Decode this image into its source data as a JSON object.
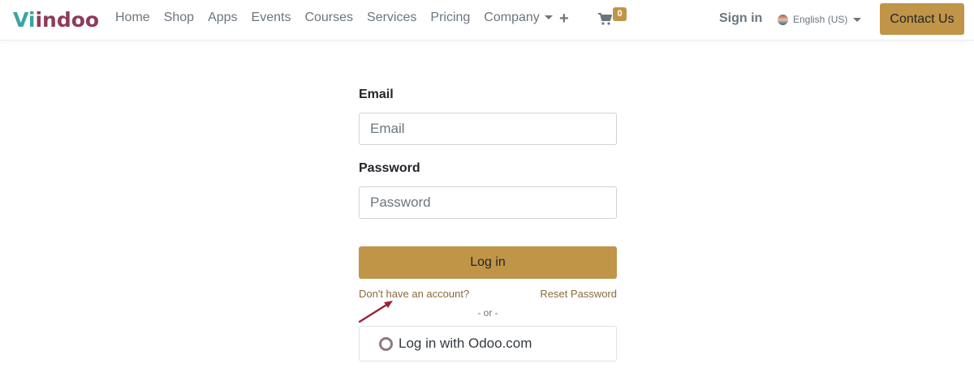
{
  "brand": {
    "logo_first": "Vi",
    "logo_rest": "indoo"
  },
  "nav": {
    "items": [
      {
        "label": "Home"
      },
      {
        "label": "Shop"
      },
      {
        "label": "Apps"
      },
      {
        "label": "Events"
      },
      {
        "label": "Courses"
      },
      {
        "label": "Services"
      },
      {
        "label": "Pricing"
      },
      {
        "label": "Company"
      }
    ],
    "cart_count": "0",
    "signin_label": "Sign in",
    "language": "English (US)",
    "contact_label": "Contact Us"
  },
  "login": {
    "email_label": "Email",
    "email_placeholder": "Email",
    "password_label": "Password",
    "password_placeholder": "Password",
    "submit_label": "Log in",
    "signup_link": "Don't have an account?",
    "reset_link": "Reset Password",
    "or_text": "- or -",
    "oauth_label": "Log in with Odoo.com"
  },
  "colors": {
    "accent": "#c09548",
    "logo_teal": "#3aa3a3",
    "logo_maroon": "#8e3a59",
    "annotation_arrow": "#9b2335"
  },
  "icons": [
    "plus-icon",
    "cart-icon",
    "flag-icon",
    "odoo-icon",
    "annotation-arrow"
  ]
}
